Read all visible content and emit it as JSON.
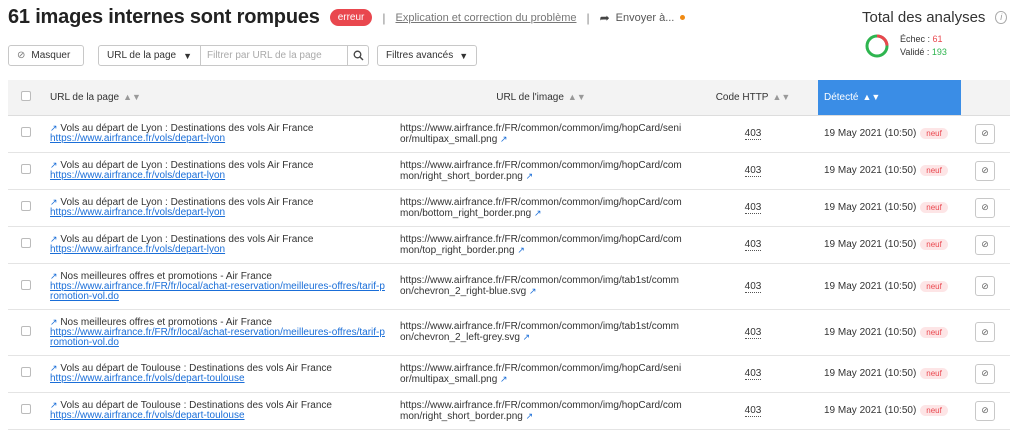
{
  "header": {
    "title": "61 images internes sont rompues",
    "error_badge": "erreur",
    "separator": "|",
    "explain_link": "Explication et correction du problème",
    "send_label": "Envoyer à..."
  },
  "analyses": {
    "title": "Total des analyses",
    "fail_label": "Échec",
    "fail_value": "61",
    "ok_label": "Validé",
    "ok_value": "193",
    "fail_color": "#e9474e",
    "ok_color": "#2eb54f"
  },
  "filters": {
    "hide_label": "Masquer",
    "url_select": "URL de la page",
    "filter_placeholder": "Filtrer par URL de la page",
    "advanced_label": "Filtres avancés"
  },
  "table": {
    "headers": {
      "page_url": "URL de la page",
      "image_url": "URL de l'image",
      "http_code": "Code HTTP",
      "detected": "Détecté"
    },
    "rows": [
      {
        "page_title": "Vols au départ de Lyon : Destinations des vols Air France",
        "page_url": "https://www.airfrance.fr/vols/depart-lyon",
        "image_url": "https://www.airfrance.fr/FR/common/common/img/hopCard/senior/multipax_small.png",
        "code": "403",
        "date": "19 May 2021 (10:50)",
        "badge": "neuf"
      },
      {
        "page_title": "Vols au départ de Lyon : Destinations des vols Air France",
        "page_url": "https://www.airfrance.fr/vols/depart-lyon",
        "image_url": "https://www.airfrance.fr/FR/common/common/img/hopCard/common/right_short_border.png",
        "code": "403",
        "date": "19 May 2021 (10:50)",
        "badge": "neuf"
      },
      {
        "page_title": "Vols au départ de Lyon : Destinations des vols Air France",
        "page_url": "https://www.airfrance.fr/vols/depart-lyon",
        "image_url": "https://www.airfrance.fr/FR/common/common/img/hopCard/common/bottom_right_border.png",
        "code": "403",
        "date": "19 May 2021 (10:50)",
        "badge": "neuf"
      },
      {
        "page_title": "Vols au départ de Lyon : Destinations des vols Air France",
        "page_url": "https://www.airfrance.fr/vols/depart-lyon",
        "image_url": "https://www.airfrance.fr/FR/common/common/img/hopCard/common/top_right_border.png",
        "code": "403",
        "date": "19 May 2021 (10:50)",
        "badge": "neuf"
      },
      {
        "page_title": "Nos meilleures offres et promotions - Air France",
        "page_url": "https://www.airfrance.fr/FR/fr/local/achat-reservation/meilleures-offres/tarif-promotion-vol.do",
        "image_url": "https://www.airfrance.fr/FR/common/common/img/tab1st/common/chevron_2_right-blue.svg",
        "code": "403",
        "date": "19 May 2021 (10:50)",
        "badge": "neuf"
      },
      {
        "page_title": "Nos meilleures offres et promotions - Air France",
        "page_url": "https://www.airfrance.fr/FR/fr/local/achat-reservation/meilleures-offres/tarif-promotion-vol.do",
        "image_url": "https://www.airfrance.fr/FR/common/common/img/tab1st/common/chevron_2_left-grey.svg",
        "code": "403",
        "date": "19 May 2021 (10:50)",
        "badge": "neuf"
      },
      {
        "page_title": "Vols au départ de Toulouse : Destinations des vols Air France",
        "page_url": "https://www.airfrance.fr/vols/depart-toulouse",
        "image_url": "https://www.airfrance.fr/FR/common/common/img/hopCard/senior/multipax_small.png",
        "code": "403",
        "date": "19 May 2021 (10:50)",
        "badge": "neuf"
      },
      {
        "page_title": "Vols au départ de Toulouse : Destinations des vols Air France",
        "page_url": "https://www.airfrance.fr/vols/depart-toulouse",
        "image_url": "https://www.airfrance.fr/FR/common/common/img/hopCard/common/right_short_border.png",
        "code": "403",
        "date": "19 May 2021 (10:50)",
        "badge": "neuf"
      }
    ]
  }
}
